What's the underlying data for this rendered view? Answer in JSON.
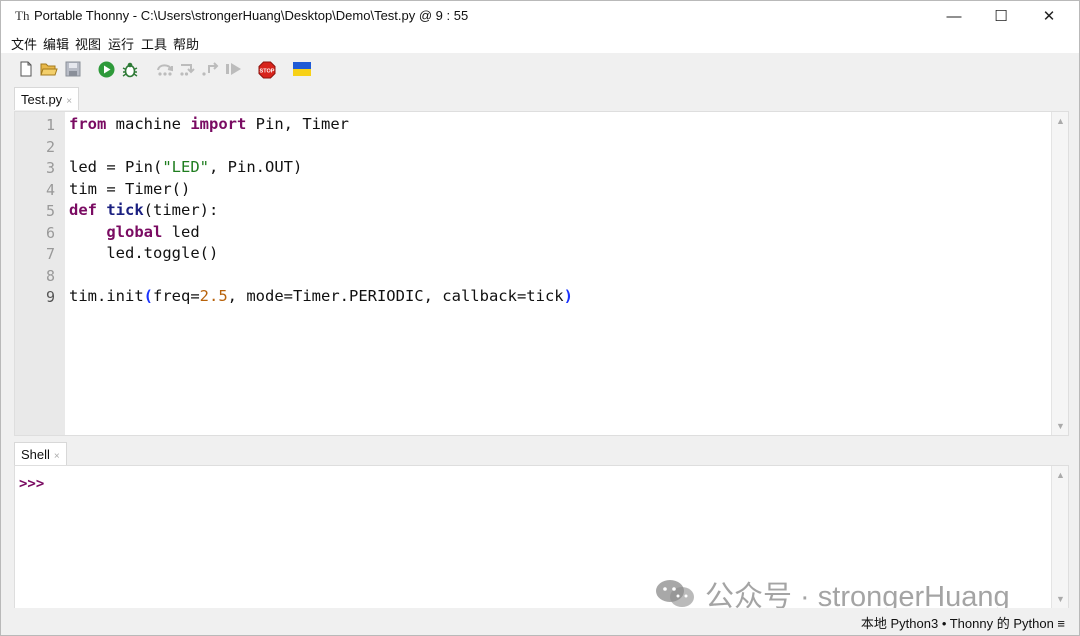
{
  "window": {
    "title": "Portable Thonny  -  C:\\Users\\strongerHuang\\Desktop\\Demo\\Test.py  @  9 : 55",
    "app_icon": "Th",
    "controls": {
      "minimize": "—",
      "maximize": "☐",
      "close": "✕"
    }
  },
  "menu": [
    "文件",
    "编辑",
    "视图",
    "运行",
    "工具",
    "帮助"
  ],
  "toolbar": [
    "new-file-icon",
    "open-folder-icon",
    "save-icon",
    "run-icon",
    "debug-icon",
    "step-over-icon",
    "step-into-icon",
    "step-out-icon",
    "resume-icon",
    "stop-icon",
    "ukraine-flag-icon"
  ],
  "editor": {
    "tab_label": "Test.py",
    "tab_close": "×",
    "line_numbers": [
      "1",
      "2",
      "3",
      "4",
      "5",
      "6",
      "7",
      "8",
      "9"
    ]
  },
  "shell": {
    "tab_label": "Shell",
    "tab_close": "×",
    "prompt": ">>>"
  },
  "watermark": "公众号 · strongerHuang",
  "status": "本地 Python3  •  Thonny 的 Python  ≡"
}
